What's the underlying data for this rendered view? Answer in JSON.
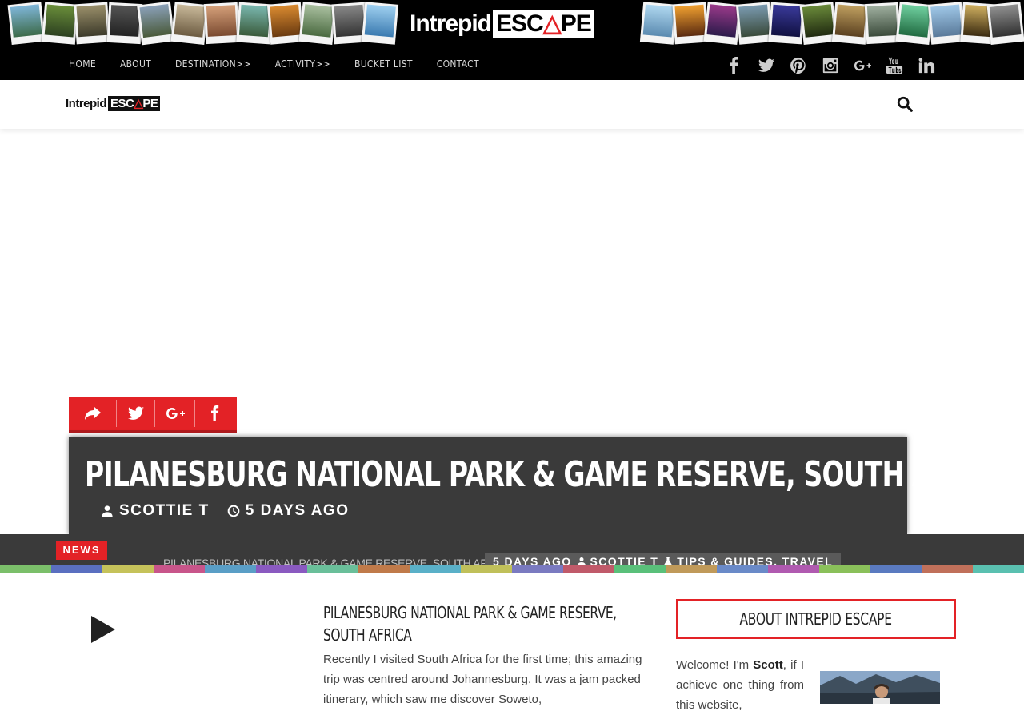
{
  "site": {
    "brand_part1": "Intrepid",
    "brand_part2_pre": "ESC",
    "brand_part2_tri": "△",
    "brand_part2_post": "PE"
  },
  "nav": {
    "items": [
      "HOME",
      "ABOUT",
      "DESTINATION>>",
      "ACTIVITY>>",
      "BUCKET LIST",
      "CONTACT"
    ]
  },
  "social": {
    "icons": [
      "facebook-icon",
      "twitter-icon",
      "pinterest-icon",
      "instagram-icon",
      "google-plus-icon",
      "youtube-icon",
      "linkedin-icon"
    ]
  },
  "share": {
    "icons": [
      "share-icon",
      "twitter-icon",
      "google-plus-icon",
      "facebook-icon"
    ]
  },
  "article": {
    "title": "PILANESBURG NATIONAL PARK & GAME RESERVE, SOUTH AFRICA",
    "author": "SCOTTIE T",
    "time": "5 DAYS AGO"
  },
  "ticker": {
    "badge": "NEWS",
    "headline": "PILANESBURG NATIONAL PARK & GAME RESERVE, SOUTH AFRICA",
    "time": "5 DAYS AGO",
    "author": "SCOTTIE T",
    "categories": "TIPS & GUIDES, TRAVEL"
  },
  "post": {
    "title": "PILANESBURG NATIONAL PARK & GAME RESERVE, SOUTH AFRICA",
    "excerpt": "Recently I visited South Africa for the first time; this amazing trip was centred around Johannesburg. It was a jam packed itinerary, which saw me discover Soweto,"
  },
  "sidebar": {
    "about_title": "ABOUT INTREPID ESCAPE",
    "welcome": "Welcome! I'm ",
    "name": "Scott",
    "text_rest": ", if I achieve one thing from this website,"
  },
  "colors": {
    "accent": "#e32226",
    "dark": "#3a3a3a",
    "black": "#000000"
  }
}
